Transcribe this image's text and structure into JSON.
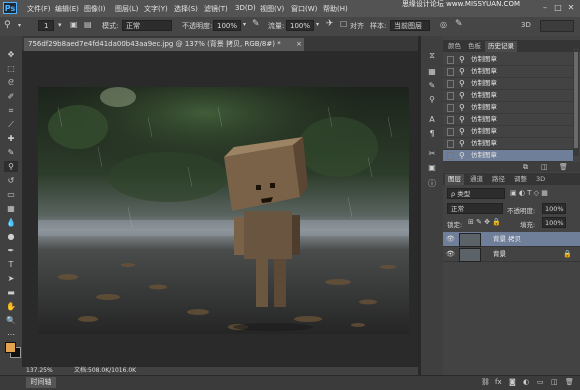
{
  "app": {
    "logo": "Ps"
  },
  "menu": [
    "文件(F)",
    "编辑(E)",
    "图像(I)",
    "图层(L)",
    "文字(Y)",
    "选择(S)",
    "滤镜(T)",
    "3D(D)",
    "视图(V)",
    "窗口(W)",
    "帮助(H)"
  ],
  "watermark": {
    "line1": "思缘设计论坛 www.MISSYUAN.COM",
    "line2": "3D"
  },
  "options": {
    "size_value": "1",
    "mode_label": "模式:",
    "mode_value": "正常",
    "opacity_label": "不透明度:",
    "opacity_value": "100%",
    "flow_label": "流量:",
    "flow_value": "100%",
    "align_label": "对齐",
    "sample_label": "样本:",
    "sample_value": "当前图层"
  },
  "document": {
    "tab_title": "756df29b8aed7e4fd41da00b43aa9ec.jpg @ 137% (背景 拷贝, RGB/8#) *",
    "close": "×",
    "zoom": "137.25%",
    "info": "文档:508.0K/1016.0K"
  },
  "bottom": {
    "timeline_tab": "时间轴"
  },
  "history_panel": {
    "tabs": [
      "颜色",
      "色板",
      "历史记录"
    ],
    "active_tab": 2,
    "items": [
      "仿制图章",
      "仿制图章",
      "仿制图章",
      "仿制图章",
      "仿制图章",
      "仿制图章",
      "仿制图章",
      "仿制图章",
      "仿制图章"
    ],
    "selected_index": 8
  },
  "layers_panel": {
    "tabs": [
      "图层",
      "通道",
      "路径",
      "调整",
      "3D"
    ],
    "active_tab": 0,
    "filter_label": "ρ 类型",
    "blend_mode": "正常",
    "opacity_label": "不透明度:",
    "opacity_value": "100%",
    "lock_label": "锁定:",
    "fill_label": "填充:",
    "fill_value": "100%",
    "layers": [
      {
        "name": "背景 拷贝",
        "selected": true,
        "locked": false
      },
      {
        "name": "背景",
        "selected": false,
        "locked": true
      }
    ]
  },
  "colors": {
    "foreground": "#e4a34e",
    "background": "#111111",
    "selection": "#6f7f99"
  }
}
